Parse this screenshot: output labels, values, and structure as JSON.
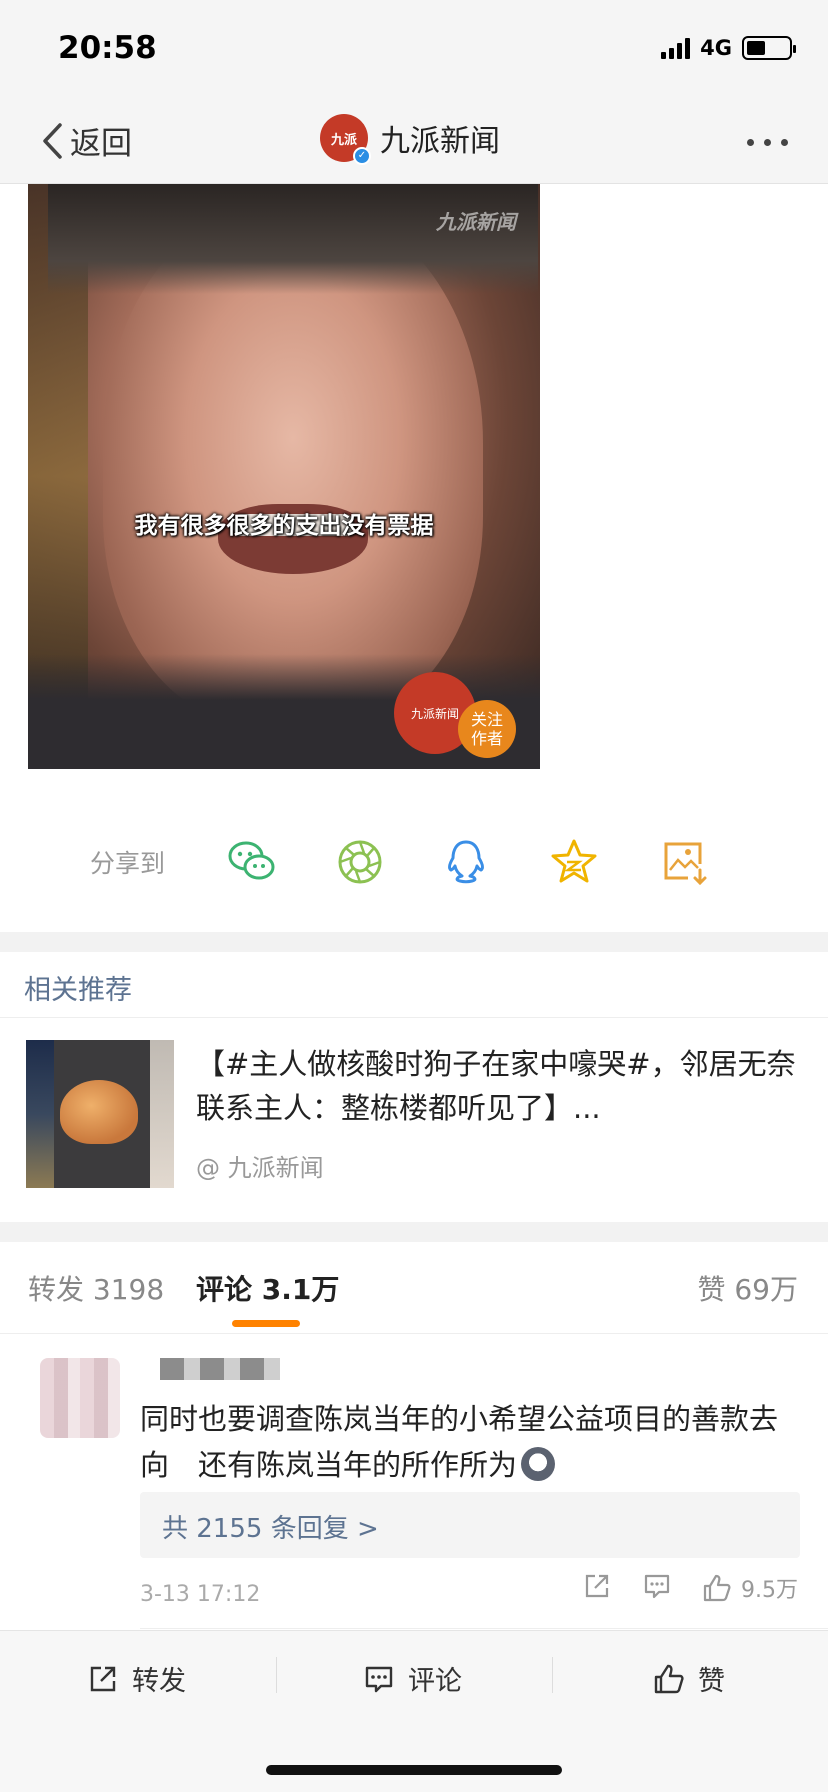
{
  "status_bar": {
    "time": "20:58",
    "network": "4G",
    "battery_level": 0.45
  },
  "nav": {
    "back_label": "返回",
    "title": "九派新闻",
    "logo_text": "九派"
  },
  "video": {
    "watermark": "九派新闻",
    "subtitle": "我有很多很多的支出没有票据",
    "badge_text": "九派新闻",
    "follow_label": "关注作者"
  },
  "share": {
    "label": "分享到",
    "targets": [
      {
        "icon": "wechat-icon",
        "color": "#3cb371"
      },
      {
        "icon": "moments-icon",
        "color": "#8cc152"
      },
      {
        "icon": "qq-icon",
        "color": "#3a8ee6"
      },
      {
        "icon": "qzone-icon",
        "color": "#f0b400"
      },
      {
        "icon": "save-image-icon",
        "color": "#e8a33a"
      }
    ]
  },
  "related": {
    "title": "相关推荐",
    "item": {
      "text": "【#主人做核酸时狗子在家中嚎哭#，邻居无奈联系主人：整栋楼都听见了】...",
      "source": "@ 九派新闻"
    }
  },
  "tabs": {
    "repost": "转发 3198",
    "comment": "评论 3.1万",
    "like": "赞 69万"
  },
  "comment": {
    "text": "同时也要调查陈岚当年的小希望公益项目的善款去向　还有陈岚当年的所作所为",
    "replies_link": "共 2155 条回复 >",
    "time": "3-13 17:12",
    "like_count": "9.5万"
  },
  "bottom_bar": {
    "repost": "转发",
    "comment": "评论",
    "like": "赞"
  },
  "colors": {
    "accent": "#ff8200",
    "link": "#5d7391",
    "brand": "#c43a27"
  }
}
